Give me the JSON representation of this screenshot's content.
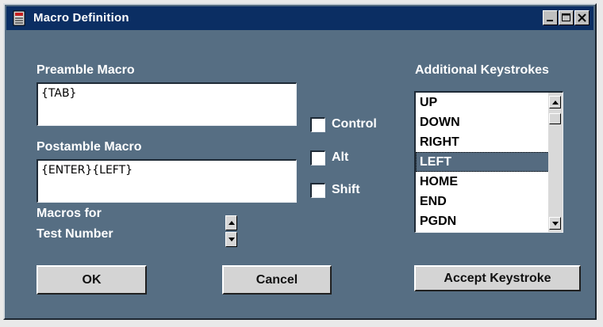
{
  "window": {
    "title": "Macro Definition"
  },
  "title_buttons": {
    "minimize": "minimize-icon",
    "maximize": "maximize-icon",
    "close": "close-icon"
  },
  "preamble": {
    "label": "Preamble Macro",
    "value": "{TAB}"
  },
  "postamble": {
    "label": "Postamble Macro",
    "value": "{ENTER}{LEFT}"
  },
  "modifiers": [
    {
      "label": "Control",
      "checked": false
    },
    {
      "label": "Alt",
      "checked": false
    },
    {
      "label": "Shift",
      "checked": false
    }
  ],
  "macros_for": {
    "line1": "Macros for",
    "line2": "Test Number"
  },
  "keystrokes": {
    "label": "Additional Keystrokes",
    "items": [
      "UP",
      "DOWN",
      "RIGHT",
      "LEFT",
      "HOME",
      "END",
      "PGDN"
    ],
    "selected": "LEFT"
  },
  "buttons": {
    "ok": "OK",
    "cancel": "Cancel",
    "accept": "Accept Keystroke"
  },
  "colors": {
    "window_bg": "#566e83",
    "titlebar": "#0b2e63",
    "selection": "#556b80"
  }
}
